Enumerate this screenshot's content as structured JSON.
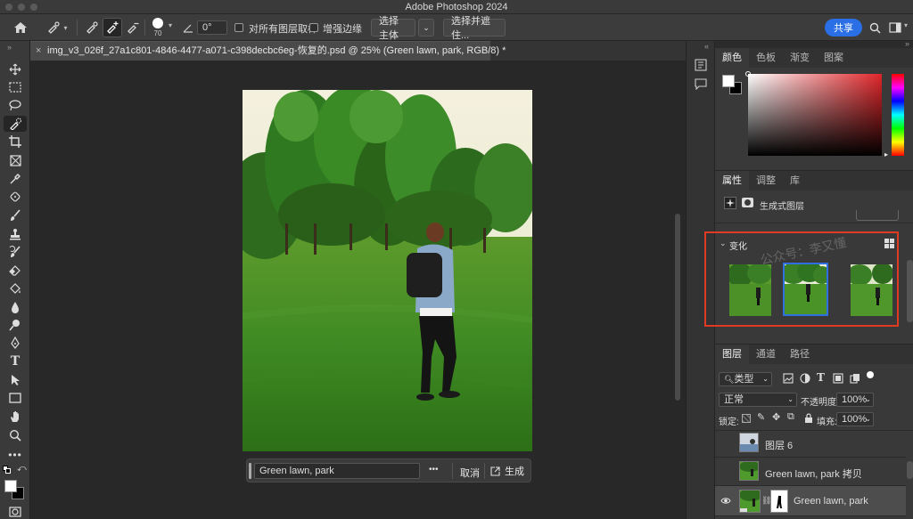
{
  "app": {
    "title": "Adobe Photoshop 2024"
  },
  "options_bar": {
    "brush_size": "70",
    "angle": "0°",
    "sample_all_layers": "对所有图层取样",
    "enhance_edge": "增强边缘",
    "select_subject": "选择主体",
    "select_and_mask": "选择并遮住...",
    "share": "共享"
  },
  "document": {
    "tab_title": "img_v3_026f_27a1c801-4846-4477-a071-c398decbc6eg-恢复的.psd @ 25% (Green lawn, park, RGB/8) *"
  },
  "context_bar": {
    "prompt_value": "Green lawn, park",
    "more": "•••",
    "cancel": "取消",
    "generate": "生成"
  },
  "color_panel": {
    "tabs": [
      "颜色",
      "色板",
      "渐变",
      "图案"
    ],
    "active_tab": 0,
    "hue_color": "#e0262a"
  },
  "properties_panel": {
    "tabs": [
      "属性",
      "调整",
      "库"
    ],
    "active_tab": 0,
    "layer_type": "生成式图层",
    "variations_label": "变化",
    "watermark": "公众号：李又懂",
    "selected_variation": 1,
    "highlight_color": "#e03a22",
    "selection_color": "#2f6fe0"
  },
  "layers_panel": {
    "tabs": [
      "图层",
      "通道",
      "路径"
    ],
    "active_tab": 0,
    "filter_kind": "类型",
    "blend_mode": "正常",
    "opacity_label": "不透明度:",
    "opacity_value": "100%",
    "lock_label": "锁定:",
    "fill_label": "填充:",
    "fill_value": "100%",
    "layers": [
      {
        "name": "图层 6",
        "visible": false
      },
      {
        "name": "Green lawn, park 拷贝",
        "visible": false
      },
      {
        "name": "Green lawn, park",
        "visible": true,
        "selected": true
      }
    ]
  }
}
